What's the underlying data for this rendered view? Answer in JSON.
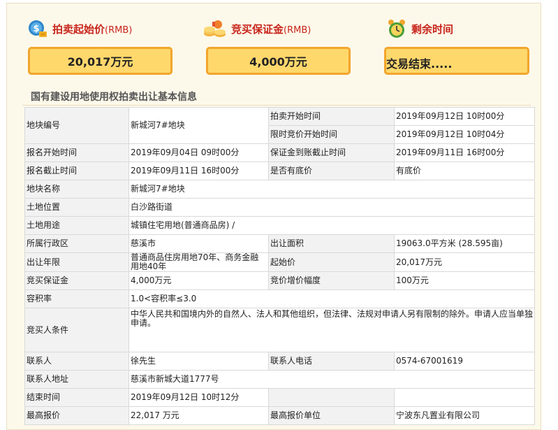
{
  "header": {
    "start_price_label": "拍卖起始价",
    "start_price_unit": "(RMB)",
    "deposit_label": "竞买保证金",
    "deposit_unit": "(RMB)",
    "remaining_label": "剩余时间",
    "start_price_value": "20,017万元",
    "deposit_value": "4,000万元",
    "remaining_value": "交易结束....."
  },
  "section_title": "国有建设用地使用权拍卖出让基本信息",
  "info": {
    "plot_no_label": "地块编号",
    "plot_no_value": "新城河7#地块",
    "auction_start_label": "拍卖开始时间",
    "auction_start_value": "2019年09月12日 10时00分",
    "limited_bid_start_label": "限时竞价开始时间",
    "limited_bid_start_value": "2019年09月12日 10时04分",
    "reg_start_label": "报名开始时间",
    "reg_start_value": "2019年09月04日 09时00分",
    "deposit_deadline_label": "保证金到账截止时间",
    "deposit_deadline_value": "2019年09月11日 16时00分",
    "reg_end_label": "报名截止时间",
    "reg_end_value": "2019年09月11日 16时00分",
    "reserve_label": "是否有底价",
    "reserve_value": "有底价",
    "plot_name_label": "地块名称",
    "plot_name_value": "新城河7#地块",
    "location_label": "土地位置",
    "location_value": "白沙路街道",
    "usage_label": "土地用途",
    "usage_value": "城镇住宅用地(普通商品房) /",
    "district_label": "所属行政区",
    "district_value": "慈溪市",
    "area_label": "出让面积",
    "area_value": "19063.0平方米 (28.595亩)",
    "term_label": "出让年限",
    "term_value": "普通商品住房用地70年、商务金融用地40年",
    "start_price_label": "起始价",
    "start_price_value": "20,017万元",
    "deposit_label": "竞买保证金",
    "deposit_value": "4,000万元",
    "increment_label": "竞价增价幅度",
    "increment_value": "100万元",
    "far_label": "容积率",
    "far_value": "1.0<容积率≤3.0",
    "bidder_cond_label": "竞买人条件",
    "bidder_cond_value": "中华人民共和国境内外的自然人、法人和其他组织，但法律、法规对申请人另有限制的除外。申请人应当单独申请。",
    "contact_label": "联系人",
    "contact_value": "徐先生",
    "phone_label": "联系人电话",
    "phone_value": "0574-67001619",
    "address_label": "联系人地址",
    "address_value": "慈溪市新城大道1777号",
    "end_time_label": "结束时间",
    "end_time_value": "2019年09月12日 10时12分",
    "top_bid_label": "最高报价",
    "top_bid_value": "22,017 万元",
    "top_bidder_label": "最高报价单位",
    "top_bidder_value": "宁波东凡置业有限公司"
  },
  "icons": {
    "money": "money-icon",
    "coins": "coins-icon",
    "clock": "clock-icon"
  },
  "colors": {
    "label_red": "#c8251c",
    "box_fill": "#ffd86c",
    "box_border": "#f2a52c",
    "page_bg": "#fdf9ea"
  }
}
